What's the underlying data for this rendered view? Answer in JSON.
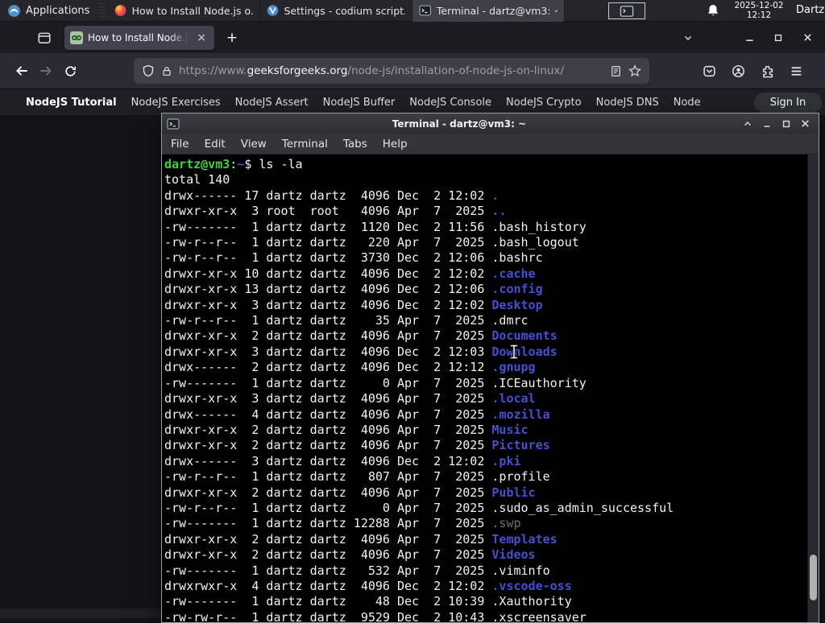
{
  "panel": {
    "applications_label": "Applications",
    "window_buttons": [
      {
        "label": "How to Install Node.js o...",
        "icon": "firefox"
      },
      {
        "label": "Settings - codium script...",
        "icon": "vscodium"
      },
      {
        "label": "Terminal - dartz@vm3: ~",
        "icon": "terminal"
      }
    ],
    "clock_date": "2025-12-02",
    "clock_time": "12:12",
    "username": "Dartz"
  },
  "browser": {
    "tab_title": "How to Install Node.js on",
    "tab_close_glyph": "×",
    "new_tab_glyph": "+",
    "url_prefix": "https://www.",
    "url_domain": "geeksforgeeks.org",
    "url_path": "/node-js/installation-of-node-js-on-linux/",
    "site_nav": {
      "primary": "NodeJS Tutorial",
      "links": [
        "NodeJS Exercises",
        "NodeJS Assert",
        "NodeJS Buffer",
        "NodeJS Console",
        "NodeJS Crypto",
        "NodeJS DNS",
        "Node"
      ],
      "signin_label": "Sign In"
    }
  },
  "terminal": {
    "title": "Terminal - dartz@vm3: ~",
    "menu": [
      "File",
      "Edit",
      "View",
      "Terminal",
      "Tabs",
      "Help"
    ],
    "prompt": {
      "user_host": "dartz@vm3",
      "separator": ":",
      "cwd": "~",
      "dollar": "$ ",
      "command": "ls -la"
    },
    "total_line": "total 140",
    "listing": [
      {
        "pre": "drwx------ 17 dartz dartz  4096 Dec  2 12:02 ",
        "name": ".",
        "type": "dir"
      },
      {
        "pre": "drwxr-xr-x  3 root  root   4096 Apr  7  2025 ",
        "name": "..",
        "type": "dir"
      },
      {
        "pre": "-rw-------  1 dartz dartz  1120 Dec  2 11:56 ",
        "name": ".bash_history",
        "type": "file"
      },
      {
        "pre": "-rw-r--r--  1 dartz dartz   220 Apr  7  2025 ",
        "name": ".bash_logout",
        "type": "file"
      },
      {
        "pre": "-rw-r--r--  1 dartz dartz  3730 Dec  2 12:06 ",
        "name": ".bashrc",
        "type": "file"
      },
      {
        "pre": "drwxr-xr-x 10 dartz dartz  4096 Dec  2 12:02 ",
        "name": ".cache",
        "type": "dir"
      },
      {
        "pre": "drwxr-xr-x 13 dartz dartz  4096 Dec  2 12:06 ",
        "name": ".config",
        "type": "dir"
      },
      {
        "pre": "drwxr-xr-x  3 dartz dartz  4096 Dec  2 12:02 ",
        "name": "Desktop",
        "type": "dir"
      },
      {
        "pre": "-rw-r--r--  1 dartz dartz    35 Apr  7  2025 ",
        "name": ".dmrc",
        "type": "file"
      },
      {
        "pre": "drwxr-xr-x  2 dartz dartz  4096 Apr  7  2025 ",
        "name": "Documents",
        "type": "dir"
      },
      {
        "pre": "drwxr-xr-x  3 dartz dartz  4096 Dec  2 12:03 ",
        "name": "Downloads",
        "type": "dir"
      },
      {
        "pre": "drwx------  2 dartz dartz  4096 Dec  2 12:12 ",
        "name": ".gnupg",
        "type": "dir"
      },
      {
        "pre": "-rw-------  1 dartz dartz     0 Apr  7  2025 ",
        "name": ".ICEauthority",
        "type": "file"
      },
      {
        "pre": "drwxr-xr-x  3 dartz dartz  4096 Apr  7  2025 ",
        "name": ".local",
        "type": "dir"
      },
      {
        "pre": "drwx------  4 dartz dartz  4096 Apr  7  2025 ",
        "name": ".mozilla",
        "type": "dir"
      },
      {
        "pre": "drwxr-xr-x  2 dartz dartz  4096 Apr  7  2025 ",
        "name": "Music",
        "type": "dir"
      },
      {
        "pre": "drwxr-xr-x  2 dartz dartz  4096 Apr  7  2025 ",
        "name": "Pictures",
        "type": "dir"
      },
      {
        "pre": "drwx------  3 dartz dartz  4096 Dec  2 12:02 ",
        "name": ".pki",
        "type": "dir"
      },
      {
        "pre": "-rw-r--r--  1 dartz dartz   807 Apr  7  2025 ",
        "name": ".profile",
        "type": "file"
      },
      {
        "pre": "drwxr-xr-x  2 dartz dartz  4096 Apr  7  2025 ",
        "name": "Public",
        "type": "dir"
      },
      {
        "pre": "-rw-r--r--  1 dartz dartz     0 Apr  7  2025 ",
        "name": ".sudo_as_admin_successful",
        "type": "file"
      },
      {
        "pre": "-rw-------  1 dartz dartz 12288 Apr  7  2025 ",
        "name": ".swp",
        "type": "dim"
      },
      {
        "pre": "drwxr-xr-x  2 dartz dartz  4096 Apr  7  2025 ",
        "name": "Templates",
        "type": "dir"
      },
      {
        "pre": "drwxr-xr-x  2 dartz dartz  4096 Apr  7  2025 ",
        "name": "Videos",
        "type": "dir"
      },
      {
        "pre": "-rw-------  1 dartz dartz   532 Apr  7  2025 ",
        "name": ".viminfo",
        "type": "file"
      },
      {
        "pre": "drwxrwxr-x  4 dartz dartz  4096 Dec  2 12:02 ",
        "name": ".vscode-oss",
        "type": "dir"
      },
      {
        "pre": "-rw-------  1 dartz dartz    48 Dec  2 10:39 ",
        "name": ".Xauthority",
        "type": "file"
      },
      {
        "pre": "-rw-rw-r--  1 dartz dartz  9529 Dec  2 10:43 ",
        "name": ".xscreensaver",
        "type": "file"
      }
    ]
  },
  "colors": {
    "prompt_green": "#3fd33f",
    "dir_blue": "#4650cf",
    "gfg_green": "#2f9d4e",
    "panel_bg": "#25252a",
    "tab_active_bg": "#42414d"
  }
}
